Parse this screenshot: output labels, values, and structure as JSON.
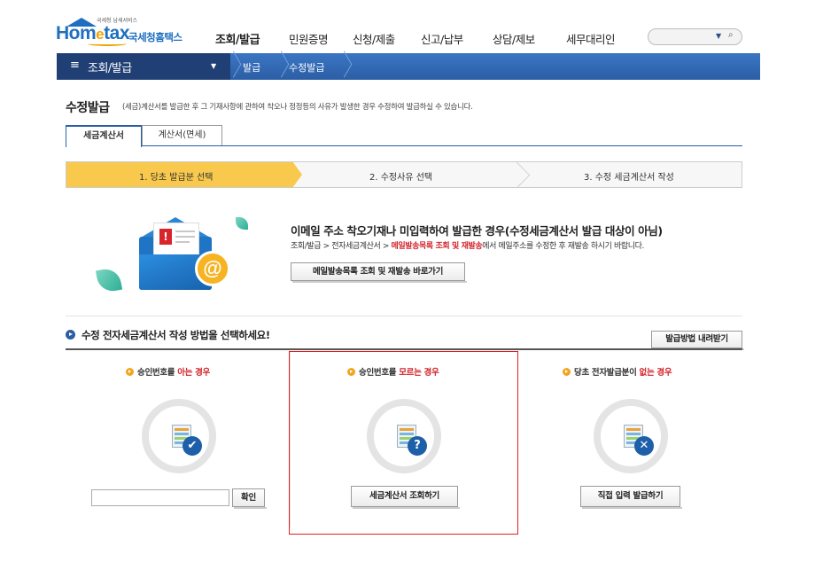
{
  "header": {
    "logo_mini": "국세청 납세서비스",
    "logo_text_a": "Hom",
    "logo_text_e": "e",
    "logo_text_b": "tax",
    "logo_sub": "국세청홈택스",
    "menu": [
      "조회/발급",
      "민원증명",
      "신청/제출",
      "신고/납부",
      "상담/제보",
      "세무대리인"
    ],
    "search_placeholder": ""
  },
  "navbar": {
    "title": "조회/발급",
    "crumbs": [
      "발급",
      "수정발급"
    ]
  },
  "page": {
    "title": "수정발급",
    "description": "(세금)계산서를 발급한 후 그 기재사항에 관하여 착오나 정정등의 사유가 발생한 경우 수정하여 발급하실 수 있습니다."
  },
  "tabs": [
    {
      "label": "세금계산서",
      "active": true
    },
    {
      "label": "계산서(면세)",
      "active": false
    }
  ],
  "steps": [
    "1. 당초 발급분 선택",
    "2. 수정사유 선택",
    "3. 수정 세금계산서 작성"
  ],
  "info": {
    "title": "이메일 주소 착오기재나 미입력하여 발급한 경우(수정세금계산서 발급 대상이 아님)",
    "text_prefix": "조회/발급 > 전자세금계산서 > ",
    "text_highlight": "메일발송목록 조회 및 재발송",
    "text_suffix": "에서 메일주소를 수정한 후 재발송 하시기 바랍니다.",
    "button": "메일발송목록 조회 및 재발송 바로가기"
  },
  "method": {
    "title": "수정 전자세금계산서 작성 방법을 선택하세요!",
    "download_button": "발급방법 내려받기",
    "columns": [
      {
        "title_prefix": "승인번호를 ",
        "title_red": "아는 경우",
        "title_suffix": "",
        "badge": "✔",
        "button": "확인",
        "input_value": ""
      },
      {
        "title_prefix": "승인번호를 ",
        "title_red": "모르는 경우",
        "title_suffix": "",
        "badge": "?",
        "button": "세금계산서 조회하기"
      },
      {
        "title_prefix": "당초 전자발급분이 ",
        "title_red": "없는 경우",
        "title_suffix": "",
        "badge": "✕",
        "button": "직접 입력 발급하기"
      }
    ]
  },
  "colors": {
    "brand_blue": "#2b5ea5",
    "step_active": "#f8c94d",
    "highlight_red": "#d2232a",
    "selection_box": "#e02020"
  }
}
